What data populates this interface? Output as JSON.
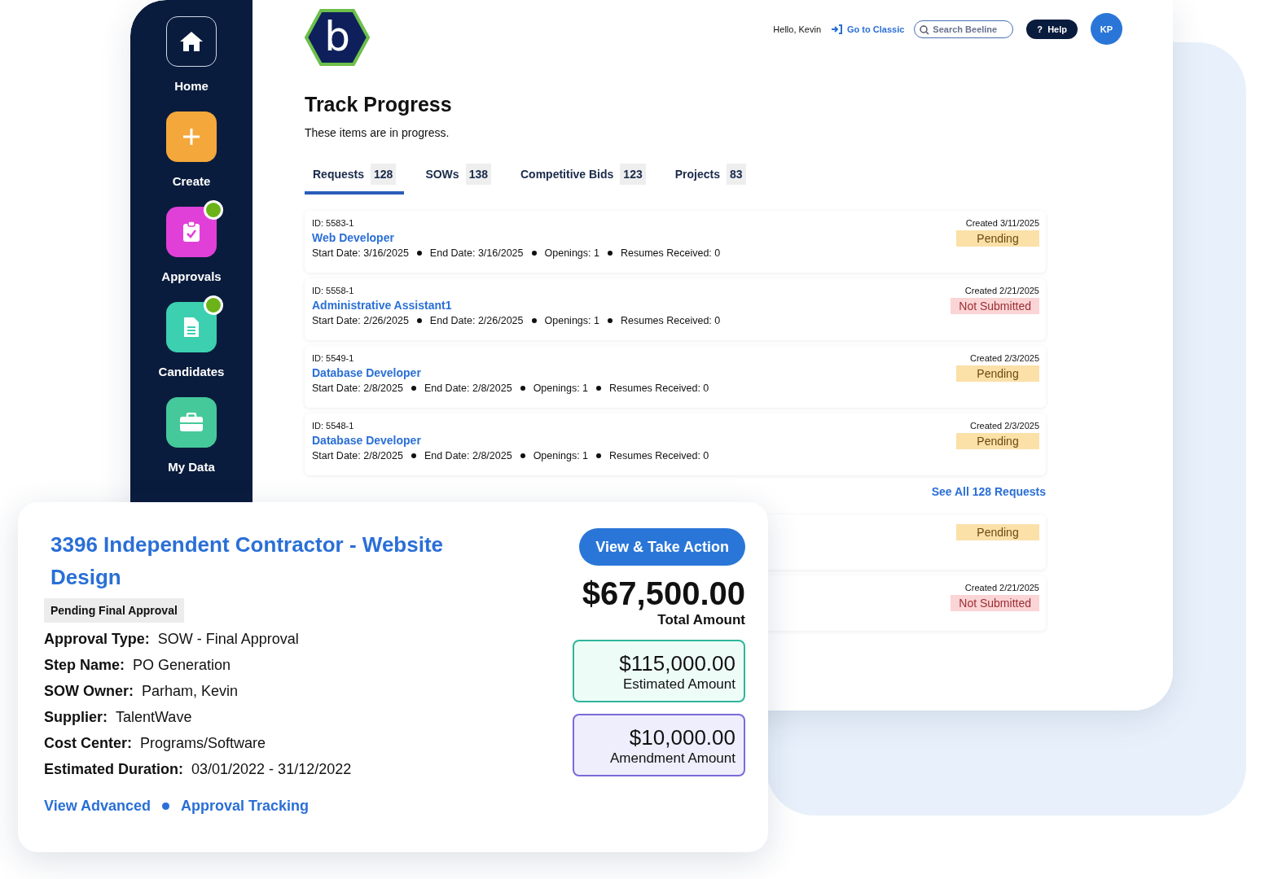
{
  "logo": {
    "letter": "b"
  },
  "sidebar": {
    "items": [
      {
        "label": "Home",
        "kind": "home",
        "notification": false
      },
      {
        "label": "Create",
        "kind": "create",
        "notification": false
      },
      {
        "label": "Approvals",
        "kind": "approvals",
        "notification": true
      },
      {
        "label": "Candidates",
        "kind": "candidates",
        "notification": true
      },
      {
        "label": "My Data",
        "kind": "data",
        "notification": false
      }
    ]
  },
  "header": {
    "greeting": "Hello, Kevin",
    "classic_link": "Go to Classic",
    "search": {
      "placeholder": "Search Beeline"
    },
    "help": "Help",
    "help_mark": "?",
    "avatar": "KP"
  },
  "page": {
    "title": "Track Progress",
    "subtitle": "These items are in progress."
  },
  "tabs": [
    {
      "label": "Requests",
      "count": "128",
      "selected": true
    },
    {
      "label": "SOWs",
      "count": "138",
      "selected": false
    },
    {
      "label": "Competitive Bids",
      "count": "123",
      "selected": false
    },
    {
      "label": "Projects",
      "count": "83",
      "selected": false
    }
  ],
  "requests": [
    {
      "id": "ID:  5583-1",
      "title": "Web Developer",
      "details": [
        "Start Date:  3/16/2025",
        "End Date:  3/16/2025",
        "Openings:  1",
        "Resumes Received:  0"
      ],
      "created": "Created 3/11/2025",
      "status": {
        "text": "Pending",
        "kind": "pending"
      }
    },
    {
      "id": "ID:  5558-1",
      "title": "Administrative Assistant1",
      "details": [
        "Start Date:  2/26/2025",
        "End Date:  2/26/2025",
        "Openings:  1",
        "Resumes Received:  0"
      ],
      "created": "Created 2/21/2025",
      "status": {
        "text": "Not Submitted",
        "kind": "not_submitted"
      }
    },
    {
      "id": "ID:  5549-1",
      "title": "Database Developer",
      "details": [
        "Start Date:  2/8/2025",
        "End Date:  2/8/2025",
        "Openings:  1",
        "Resumes Received:  0"
      ],
      "created": "Created 2/3/2025",
      "status": {
        "text": "Pending",
        "kind": "pending"
      }
    },
    {
      "id": "ID:  5548-1",
      "title": "Database Developer",
      "details": [
        "Start Date:  2/8/2025",
        "End Date:  2/8/2025",
        "Openings:  1",
        "Resumes Received:  0"
      ],
      "created": "Created 2/3/2025",
      "status": {
        "text": "Pending",
        "kind": "pending"
      }
    }
  ],
  "see_all": "See All 128 Requests",
  "more_requests": [
    {
      "status": {
        "text": "Pending",
        "kind": "pending"
      }
    },
    {
      "created": "Created 2/21/2025",
      "status": {
        "text": "Not Submitted",
        "kind": "not_submitted"
      }
    }
  ],
  "approval_card": {
    "title": "3396 Independent Contractor - Website Design",
    "badge": "Pending Final Approval",
    "fields": [
      {
        "label": "Approval Type:",
        "value": "SOW - Final Approval"
      },
      {
        "label": "Step Name:",
        "value": "PO Generation"
      },
      {
        "label": "SOW Owner:",
        "value": "Parham, Kevin"
      },
      {
        "label": "Supplier:",
        "value": "TalentWave"
      },
      {
        "label": "Cost Center:",
        "value": "Programs/Software"
      },
      {
        "label": "Estimated Duration:",
        "value": "03/01/2022 - 31/12/2022"
      }
    ],
    "links": [
      "View Advanced",
      "Approval Tracking"
    ],
    "action": "View & Take Action",
    "total": {
      "amount": "$67,500.00",
      "label": "Total Amount"
    },
    "amounts": [
      {
        "amount": "$115,000.00",
        "label": "Estimated Amount",
        "kind": "estimated"
      },
      {
        "amount": "$10,000.00",
        "label": "Amendment Amount",
        "kind": "amendment"
      }
    ]
  }
}
